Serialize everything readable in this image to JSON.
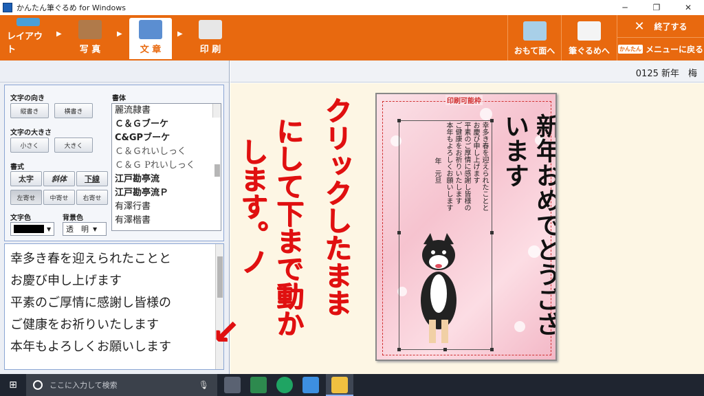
{
  "window": {
    "title": "かんたん筆ぐるめ for Windows",
    "controls": [
      "─",
      "❐",
      "✕"
    ]
  },
  "tabs": [
    {
      "label": "レイアウト",
      "active": false
    },
    {
      "label": "写 真",
      "active": false
    },
    {
      "label": "文 章",
      "active": true
    },
    {
      "label": "印 刷",
      "active": false
    }
  ],
  "right_buttons": {
    "front": "おもて面へ",
    "fudegurume": "筆ぐるめへ",
    "exit": "終了する",
    "menu": "メニューに戻る",
    "menu_badge": "かんたん"
  },
  "status": {
    "doc_label": "0125 新年　梅"
  },
  "props": {
    "direction_label": "文字の向き",
    "vertical": "縦書き",
    "horizontal": "横書き",
    "size_label": "文字の大きさ",
    "smaller": "小さく",
    "larger": "大きく",
    "style_label": "書式",
    "bold": "太字",
    "italic": "斜体",
    "underline": "下線",
    "align_left": "左寄せ",
    "align_center": "中寄せ",
    "align_right": "右寄せ",
    "color_label": "文字色",
    "text_color": "#000000",
    "bg_label": "背景色",
    "bg_value": "透　明",
    "font_label": "書体",
    "fonts": [
      "麗流隷書",
      "Ｃ＆Ｇブーケ",
      "C&GPブーケ",
      "Ｃ＆Ｇれいしっく",
      "Ｃ＆Ｇ Pれいしっく",
      "江戸勘亭流",
      "江戸勘亭流Ｐ",
      "有澤行書",
      "有澤楷書"
    ]
  },
  "editor": {
    "lines": [
      "幸多き春を迎えられたことと",
      "お慶び申し上げます",
      "平素のご厚情に感謝し皆様の",
      "ご健康をお祈りいたします",
      "本年もよろしくお願いします"
    ]
  },
  "card": {
    "print_frame_label": "印刷可能枠",
    "greeting": "新年おめでとうございます",
    "body_columns": [
      "幸多き春を迎えられたことと",
      "お慶び申し上げます",
      "平素のご厚情に感謝し皆様の",
      "ご健康をお祈りいたします",
      "本年もよろしくお願いします"
    ],
    "date_year": "年",
    "date_day": "元旦"
  },
  "annotation": {
    "col1": "クリックしたまま",
    "col2": "にして下まで動か",
    "col3": "します。ノ",
    "arrow": "↙",
    "color": "#e01010"
  },
  "taskbar": {
    "start": "⊞",
    "search_placeholder": "ここに入力して検索",
    "mic": "🎙"
  }
}
